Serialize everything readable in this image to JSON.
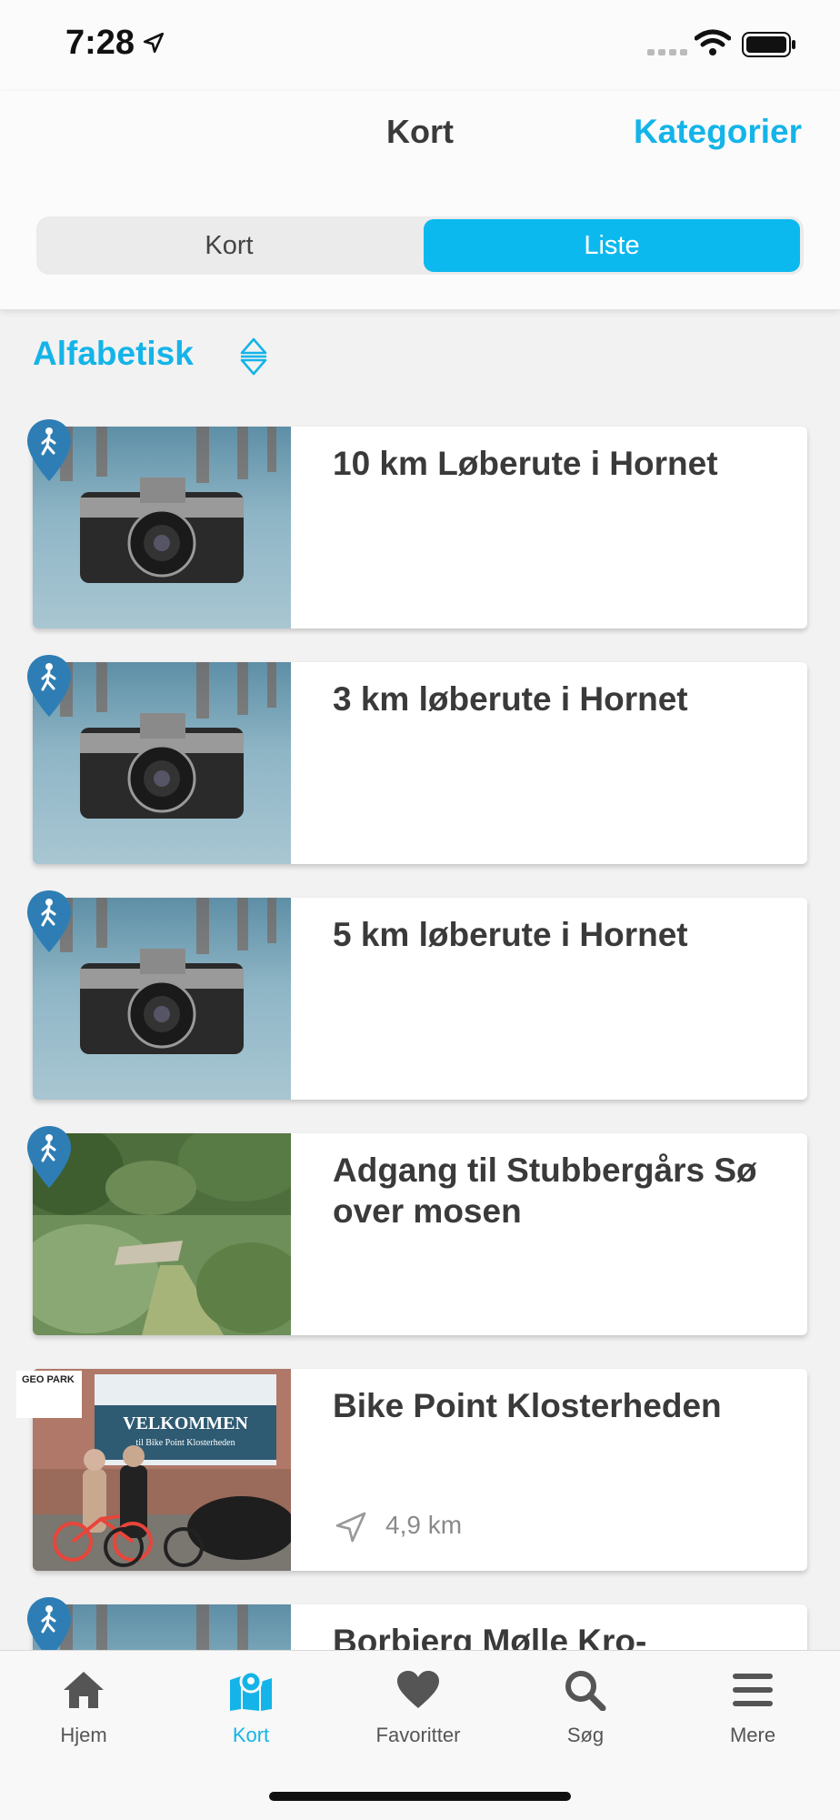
{
  "status_bar": {
    "time": "7:28"
  },
  "header": {
    "title": "Kort",
    "right_button": "Kategorier"
  },
  "segments": [
    "Kort",
    "Liste"
  ],
  "sort": {
    "label": "Alfabetisk"
  },
  "colors": {
    "accent": "#14b4e8",
    "pin": "#2e7eb5",
    "segment_active": "#0cb9ee"
  },
  "items": [
    {
      "title": "10 km Løberute i Hornet",
      "image": "camera-photo",
      "icon": "walking-pin-icon"
    },
    {
      "title": "3 km løberute i Hornet",
      "image": "camera-photo",
      "icon": "walking-pin-icon"
    },
    {
      "title": "5 km løberute i Hornet",
      "image": "camera-photo",
      "icon": "walking-pin-icon"
    },
    {
      "title": "Adgang til Stubbergårs Sø over mosen",
      "image": "bog-path-photo",
      "icon": "walking-pin-icon"
    },
    {
      "title": "Bike Point Klosterheden",
      "image": "bike-point-photo",
      "icon": "geopark-logo",
      "distance": "4,9 km",
      "logo_text": "GEO PARK"
    },
    {
      "title": "Borbjerg Mølle Kro-",
      "image": "camera-photo",
      "icon": "walking-pin-icon"
    }
  ],
  "banner": {
    "text": "VELKOMMEN",
    "subtext": "til Bike Point Klosterheden"
  },
  "tabs": [
    {
      "label": "Hjem",
      "icon": "home-icon"
    },
    {
      "label": "Kort",
      "icon": "map-icon"
    },
    {
      "label": "Favoritter",
      "icon": "heart-icon"
    },
    {
      "label": "Søg",
      "icon": "search-icon"
    },
    {
      "label": "Mere",
      "icon": "menu-icon"
    }
  ]
}
